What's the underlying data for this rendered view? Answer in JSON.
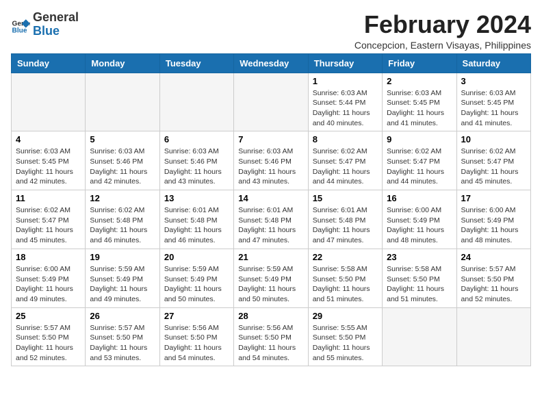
{
  "logo": {
    "general": "General",
    "blue": "Blue"
  },
  "title": "February 2024",
  "location": "Concepcion, Eastern Visayas, Philippines",
  "days_of_week": [
    "Sunday",
    "Monday",
    "Tuesday",
    "Wednesday",
    "Thursday",
    "Friday",
    "Saturday"
  ],
  "weeks": [
    [
      {
        "day": "",
        "info": ""
      },
      {
        "day": "",
        "info": ""
      },
      {
        "day": "",
        "info": ""
      },
      {
        "day": "",
        "info": ""
      },
      {
        "day": "1",
        "info": "Sunrise: 6:03 AM\nSunset: 5:44 PM\nDaylight: 11 hours and 40 minutes."
      },
      {
        "day": "2",
        "info": "Sunrise: 6:03 AM\nSunset: 5:45 PM\nDaylight: 11 hours and 41 minutes."
      },
      {
        "day": "3",
        "info": "Sunrise: 6:03 AM\nSunset: 5:45 PM\nDaylight: 11 hours and 41 minutes."
      }
    ],
    [
      {
        "day": "4",
        "info": "Sunrise: 6:03 AM\nSunset: 5:45 PM\nDaylight: 11 hours and 42 minutes."
      },
      {
        "day": "5",
        "info": "Sunrise: 6:03 AM\nSunset: 5:46 PM\nDaylight: 11 hours and 42 minutes."
      },
      {
        "day": "6",
        "info": "Sunrise: 6:03 AM\nSunset: 5:46 PM\nDaylight: 11 hours and 43 minutes."
      },
      {
        "day": "7",
        "info": "Sunrise: 6:03 AM\nSunset: 5:46 PM\nDaylight: 11 hours and 43 minutes."
      },
      {
        "day": "8",
        "info": "Sunrise: 6:02 AM\nSunset: 5:47 PM\nDaylight: 11 hours and 44 minutes."
      },
      {
        "day": "9",
        "info": "Sunrise: 6:02 AM\nSunset: 5:47 PM\nDaylight: 11 hours and 44 minutes."
      },
      {
        "day": "10",
        "info": "Sunrise: 6:02 AM\nSunset: 5:47 PM\nDaylight: 11 hours and 45 minutes."
      }
    ],
    [
      {
        "day": "11",
        "info": "Sunrise: 6:02 AM\nSunset: 5:47 PM\nDaylight: 11 hours and 45 minutes."
      },
      {
        "day": "12",
        "info": "Sunrise: 6:02 AM\nSunset: 5:48 PM\nDaylight: 11 hours and 46 minutes."
      },
      {
        "day": "13",
        "info": "Sunrise: 6:01 AM\nSunset: 5:48 PM\nDaylight: 11 hours and 46 minutes."
      },
      {
        "day": "14",
        "info": "Sunrise: 6:01 AM\nSunset: 5:48 PM\nDaylight: 11 hours and 47 minutes."
      },
      {
        "day": "15",
        "info": "Sunrise: 6:01 AM\nSunset: 5:48 PM\nDaylight: 11 hours and 47 minutes."
      },
      {
        "day": "16",
        "info": "Sunrise: 6:00 AM\nSunset: 5:49 PM\nDaylight: 11 hours and 48 minutes."
      },
      {
        "day": "17",
        "info": "Sunrise: 6:00 AM\nSunset: 5:49 PM\nDaylight: 11 hours and 48 minutes."
      }
    ],
    [
      {
        "day": "18",
        "info": "Sunrise: 6:00 AM\nSunset: 5:49 PM\nDaylight: 11 hours and 49 minutes."
      },
      {
        "day": "19",
        "info": "Sunrise: 5:59 AM\nSunset: 5:49 PM\nDaylight: 11 hours and 49 minutes."
      },
      {
        "day": "20",
        "info": "Sunrise: 5:59 AM\nSunset: 5:49 PM\nDaylight: 11 hours and 50 minutes."
      },
      {
        "day": "21",
        "info": "Sunrise: 5:59 AM\nSunset: 5:49 PM\nDaylight: 11 hours and 50 minutes."
      },
      {
        "day": "22",
        "info": "Sunrise: 5:58 AM\nSunset: 5:50 PM\nDaylight: 11 hours and 51 minutes."
      },
      {
        "day": "23",
        "info": "Sunrise: 5:58 AM\nSunset: 5:50 PM\nDaylight: 11 hours and 51 minutes."
      },
      {
        "day": "24",
        "info": "Sunrise: 5:57 AM\nSunset: 5:50 PM\nDaylight: 11 hours and 52 minutes."
      }
    ],
    [
      {
        "day": "25",
        "info": "Sunrise: 5:57 AM\nSunset: 5:50 PM\nDaylight: 11 hours and 52 minutes."
      },
      {
        "day": "26",
        "info": "Sunrise: 5:57 AM\nSunset: 5:50 PM\nDaylight: 11 hours and 53 minutes."
      },
      {
        "day": "27",
        "info": "Sunrise: 5:56 AM\nSunset: 5:50 PM\nDaylight: 11 hours and 54 minutes."
      },
      {
        "day": "28",
        "info": "Sunrise: 5:56 AM\nSunset: 5:50 PM\nDaylight: 11 hours and 54 minutes."
      },
      {
        "day": "29",
        "info": "Sunrise: 5:55 AM\nSunset: 5:50 PM\nDaylight: 11 hours and 55 minutes."
      },
      {
        "day": "",
        "info": ""
      },
      {
        "day": "",
        "info": ""
      }
    ]
  ]
}
